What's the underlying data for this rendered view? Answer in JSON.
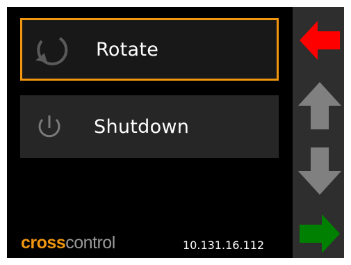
{
  "menu": {
    "items": [
      {
        "label": "Rotate",
        "icon": "rotate-icon",
        "selected": true
      },
      {
        "label": "Shutdown",
        "icon": "power-icon",
        "selected": false
      }
    ]
  },
  "sidebar": {
    "buttons": [
      {
        "name": "back",
        "icon": "arrow-left-icon",
        "color": "#ff0000"
      },
      {
        "name": "up",
        "icon": "arrow-up-icon",
        "color": "#808080"
      },
      {
        "name": "down",
        "icon": "arrow-down-icon",
        "color": "#808080"
      },
      {
        "name": "confirm",
        "icon": "arrow-right-icon",
        "color": "#008000"
      }
    ]
  },
  "footer": {
    "logo_part1": "cross",
    "logo_part2": "control",
    "ip_address": "10.131.16.112"
  },
  "colors": {
    "accent": "#f0960f",
    "background": "#000000",
    "sidebar": "#2e2e2e"
  }
}
